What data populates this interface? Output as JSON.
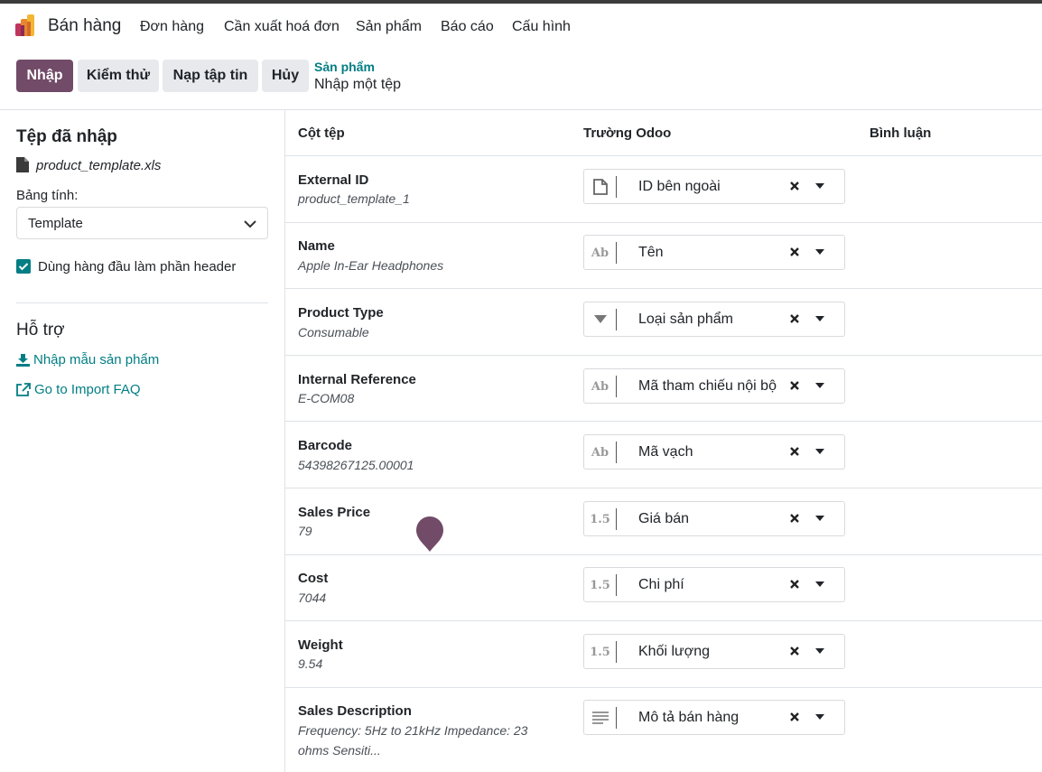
{
  "nav": {
    "app_name": "Bán hàng",
    "items": [
      "Đơn hàng",
      "Cần xuất hoá đơn",
      "Sản phẩm",
      "Báo cáo",
      "Cấu hình"
    ]
  },
  "control": {
    "buttons": [
      "Nhập",
      "Kiểm thử",
      "Nạp tập tin",
      "Hủy"
    ],
    "breadcrumb_parent": "Sản phẩm",
    "breadcrumb_current": "Nhập một tệp"
  },
  "sidebar": {
    "imported_title": "Tệp đã nhập",
    "file_name": "product_template.xls",
    "sheet_label": "Bảng tính:",
    "sheet_value": "Template",
    "header_checkbox_label": "Dùng hàng đầu làm phần header",
    "help_title": "Hỗ trợ",
    "links": [
      "Nhập mẫu sản phẩm",
      "Go to Import FAQ"
    ]
  },
  "table": {
    "headers": [
      "Cột tệp",
      "Trường Odoo",
      "Bình luận"
    ],
    "rows": [
      {
        "column": "External ID",
        "sample": "product_template_1",
        "field": "ID bên ngoài",
        "icon": "file-icon"
      },
      {
        "column": "Name",
        "sample": "Apple In-Ear Headphones",
        "field": "Tên",
        "icon": "Ab"
      },
      {
        "column": "Product Type",
        "sample": "Consumable",
        "field": "Loại sản phẩm",
        "icon": "caret-down-icon"
      },
      {
        "column": "Internal Reference",
        "sample": "E-COM08",
        "field": "Mã tham chiếu nội bộ",
        "icon": "Ab"
      },
      {
        "column": "Barcode",
        "sample": "54398267125.00001",
        "field": "Mã vạch",
        "icon": "Ab"
      },
      {
        "column": "Sales Price",
        "sample": "79",
        "field": "Giá bán",
        "icon": "1.5"
      },
      {
        "column": "Cost",
        "sample": "7044",
        "field": "Chi phí",
        "icon": "1.5"
      },
      {
        "column": "Weight",
        "sample": "9.54",
        "field": "Khối lượng",
        "icon": "1.5"
      },
      {
        "column": "Sales Description",
        "sample": "Frequency: 5Hz to 21kHz Impedance: 23 ohms Sensiti...",
        "field": "Mô tả bán hàng",
        "icon": "text-lines-icon"
      }
    ]
  },
  "colors": {
    "primary": "#714b67",
    "link": "#017e84"
  }
}
